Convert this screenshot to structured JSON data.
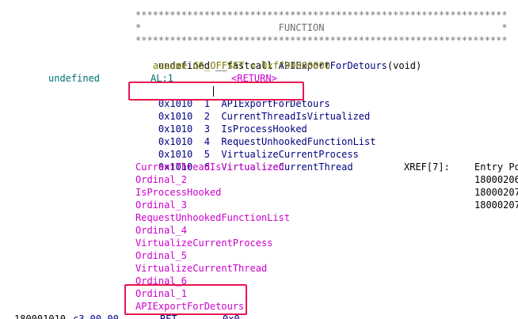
{
  "banner": {
    "stars_top": "*****************************************************************",
    "title_line": "*                        FUNCTION                               *",
    "stars_bottom": "*****************************************************************"
  },
  "signature": {
    "prefix": "undefined __fastcall ",
    "func_name": "APIExportForDetours",
    "suffix": "(void)"
  },
  "assume_line": "assume GS_OFFSET = 0xff00000000",
  "return_type": "undefined",
  "return_reg": "AL:1",
  "return_label": "<RETURN>",
  "ordinal_rows": [
    {
      "addr": "0x1010",
      "num": "1",
      "name": "APIExportForDetours"
    },
    {
      "addr": "0x1010",
      "num": "2",
      "name": "CurrentThreadIsVirtualized"
    },
    {
      "addr": "0x1010",
      "num": "3",
      "name": "IsProcessHooked"
    },
    {
      "addr": "0x1010",
      "num": "4",
      "name": "RequestUnhookedFunctionList"
    },
    {
      "addr": "0x1010",
      "num": "5",
      "name": "VirtualizeCurrentProcess"
    },
    {
      "addr": "0x1010",
      "num": "6",
      "name": "VirtualizeCurrentThread"
    }
  ],
  "labels": [
    "CurrentThreadIsVirtualized",
    "Ordinal_2",
    "IsProcessHooked",
    "Ordinal_3",
    "RequestUnhookedFunctionList",
    "Ordinal_4",
    "VirtualizeCurrentProcess",
    "Ordinal_5",
    "VirtualizeCurrentThread",
    "Ordinal_6",
    "Ordinal_1",
    "APIExportForDetours"
  ],
  "xref": {
    "label": "XREF[7]:",
    "header": "Entry Po",
    "entries": [
      "18000206",
      "18000207",
      "18000207"
    ]
  },
  "bottom_row": {
    "address": "180001010",
    "bytes": "c3 00 00",
    "mnemonic": "RET",
    "operand": "0x0"
  },
  "colors": {
    "highlight": "#e8174f",
    "label": "#cc00cc",
    "address": "#000080"
  }
}
